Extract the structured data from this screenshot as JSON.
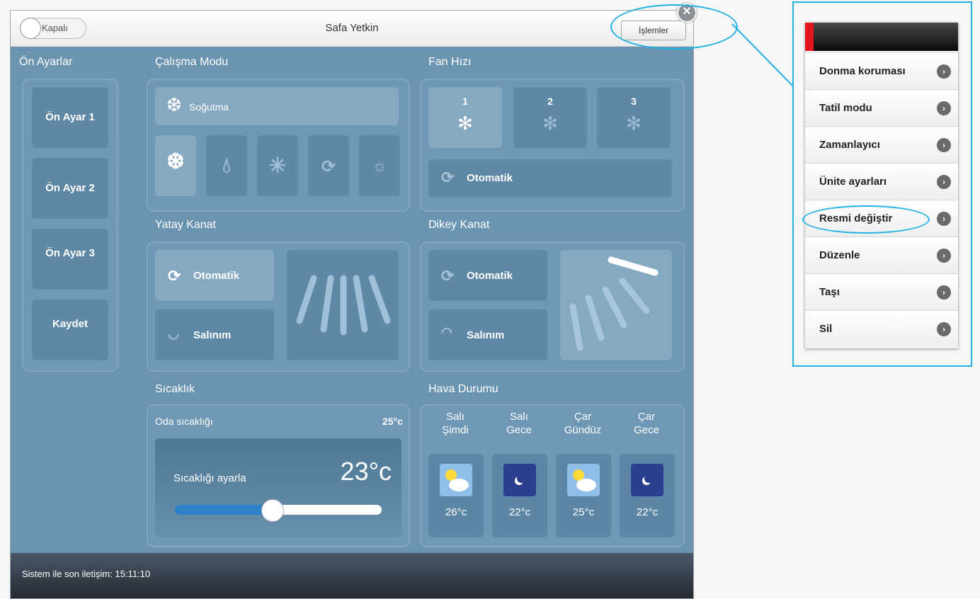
{
  "titlebar": {
    "power_toggle": "Kapalı",
    "title": "Safa Yetkin",
    "operations_button": "İşlemler"
  },
  "presets": {
    "title": "Ön Ayarlar",
    "items": [
      "Ön Ayar 1",
      "Ön Ayar 2",
      "Ön Ayar 3",
      "Kaydet"
    ]
  },
  "mode": {
    "title": "Çalışma Modu",
    "selected_label": "Soğutma",
    "modes": [
      "snowflake-icon",
      "drop-icon",
      "fan-icon",
      "auto-icon",
      "sun-icon"
    ]
  },
  "fan": {
    "title": "Fan Hızı",
    "speeds": [
      "1",
      "2",
      "3"
    ],
    "auto_label": "Otomatik"
  },
  "horizontal_vane": {
    "title": "Yatay Kanat",
    "auto_label": "Otomatik",
    "swing_label": "Salınım"
  },
  "vertical_vane": {
    "title": "Dikey Kanat",
    "auto_label": "Otomatik",
    "swing_label": "Salınım"
  },
  "temperature": {
    "title": "Sıcaklık",
    "room_label": "Oda sıcaklığı",
    "room_value": "25°c",
    "set_label": "Sıcaklığı ayarla",
    "set_value": "23°c",
    "slider_fraction": 0.47
  },
  "weather": {
    "title": "Hava Durumu",
    "columns": [
      {
        "day": "Salı",
        "period": "Şimdi",
        "temp": "26°c",
        "icon": "partly-sunny-icon"
      },
      {
        "day": "Salı",
        "period": "Gece",
        "temp": "22°c",
        "icon": "moon-icon"
      },
      {
        "day": "Çar",
        "period": "Gündüz",
        "temp": "25°c",
        "icon": "partly-sunny-icon"
      },
      {
        "day": "Çar",
        "period": "Gece",
        "temp": "22°c",
        "icon": "moon-icon"
      }
    ]
  },
  "footer": {
    "last_contact": "Sistem ile son iletişim: 15:11:10"
  },
  "menu": {
    "items": [
      "Donma koruması",
      "Tatil modu",
      "Zamanlayıcı",
      "Ünite ayarları",
      "Resmi değiştir",
      "Düzenle",
      "Taşı",
      "Sil"
    ]
  },
  "colors": {
    "panel_bg": "#6b94b1",
    "accent_highlight": "#23b1e5",
    "slider_fill": "#2d81c9"
  }
}
